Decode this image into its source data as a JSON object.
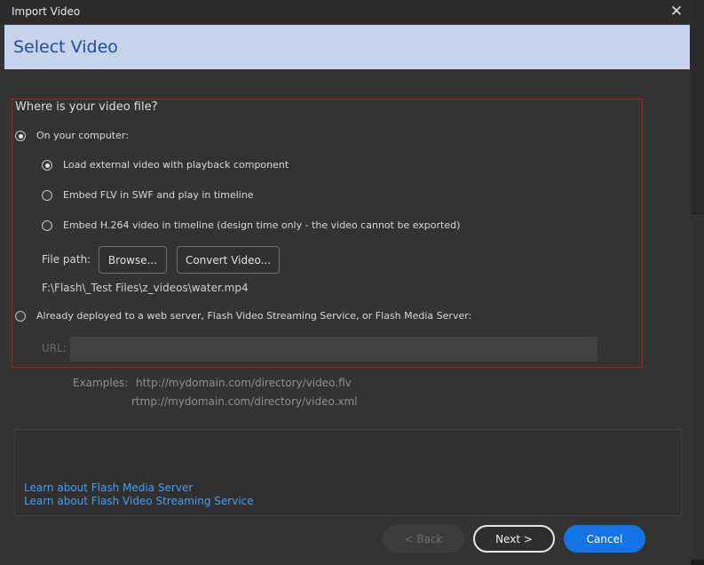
{
  "window": {
    "title": "Import Video",
    "close_glyph": "✕"
  },
  "header": {
    "title": "Select Video"
  },
  "form": {
    "question": "Where is your video file?",
    "on_computer_label": "On your computer:",
    "options": {
      "load_external": "Load external video with playback component",
      "embed_flv": "Embed FLV in SWF and play in timeline",
      "embed_h264": "Embed H.264 video in timeline (design time only - the video cannot be exported)"
    },
    "file_path_label": "File path:",
    "browse_label": "Browse...",
    "convert_label": "Convert Video...",
    "file_path_value": "F:\\Flash\\_Test Files\\z_videos\\water.mp4",
    "deployed_label": "Already deployed to a web server, Flash Video Streaming Service, or Flash Media Server:",
    "url_label": "URL:",
    "url_value": "",
    "examples_label": "Examples:",
    "example_1": "http://mydomain.com/directory/video.flv",
    "example_2": "rtmp://mydomain.com/directory/video.xml"
  },
  "links": {
    "media_server": "Learn about Flash Media Server",
    "streaming_service": "Learn about Flash Video Streaming Service"
  },
  "footer": {
    "back_label": "< Back",
    "next_label": "Next >",
    "cancel_label": "Cancel"
  },
  "colors": {
    "header_bg": "#c5d3ec",
    "header_text": "#1f4f93",
    "highlight_border": "#b01c28",
    "link": "#4a9cf0",
    "primary_button": "#1473e6"
  }
}
